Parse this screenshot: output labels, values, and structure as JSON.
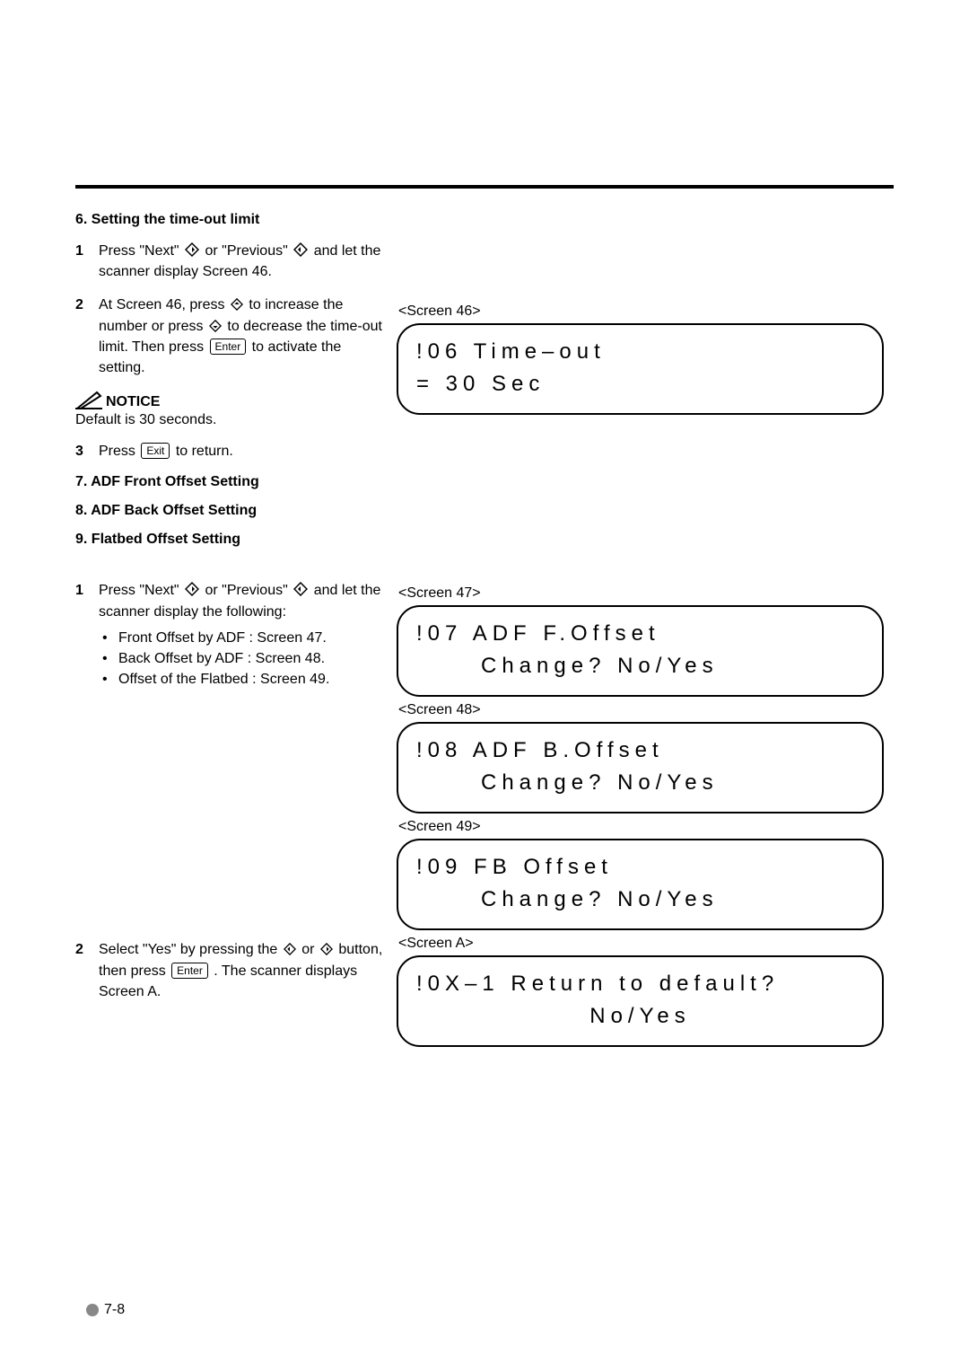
{
  "section6": {
    "heading": "6. Setting the time-out limit",
    "step1_part1": "Press \"Next\" ",
    "step1_part2": " or \"Previous\" ",
    "step1_part3": " and let the scanner display Screen 46.",
    "step2_part1": "At Screen 46, press ",
    "step2_part2": " to increase the number or press ",
    "step2_part3": " to decrease the time-out limit. Then press ",
    "step2_key_enter": "Enter",
    "step2_part4": " to activate the setting.",
    "notice_label": "NOTICE",
    "notice_text": "Default is 30 seconds.",
    "step3_part1": "Press ",
    "step3_key_exit": "Exit",
    "step3_part2": " to return."
  },
  "section7": {
    "heading": "7. ADF Front Offset Setting"
  },
  "section8": {
    "heading": "8. ADF Back Offset Setting"
  },
  "section9": {
    "heading": "9. Flatbed Offset Setting"
  },
  "offset_steps": {
    "step1_part1": "Press \"Next\" ",
    "step1_part2": " or \"Previous\" ",
    "step1_part3": " and let the scanner display the following:",
    "bullet1": "Front Offset by ADF : Screen 47.",
    "bullet2": "Back Offset by ADF : Screen 48.",
    "bullet3": "Offset of the Flatbed : Screen 49.",
    "step2_part1": "Select \"Yes\" by pressing the ",
    "step2_part2": " or ",
    "step2_part3": " button, then press ",
    "step2_key_enter": "Enter",
    "step2_part4": ". The scanner displays Screen A."
  },
  "screens": {
    "s46_label": "<Screen 46>",
    "s46_line1": "!06 Time–out",
    "s46_line2": " = 30 Sec",
    "s47_label": "<Screen 47>",
    "s47_line1": "!07 ADF F.Offset",
    "s47_line2": "Change? No/Yes",
    "s48_label": "<Screen 48>",
    "s48_line1": "!08 ADF B.Offset",
    "s48_line2": "Change? No/Yes",
    "s49_label": "<Screen 49>",
    "s49_line1": "!09 FB Offset",
    "s49_line2": "Change? No/Yes",
    "sA_label": "<Screen A>",
    "sA_line1": "!0X–1 Return to default?",
    "sA_line2": "No/Yes"
  },
  "nums": {
    "n1": "1",
    "n2": "2",
    "n3": "3"
  },
  "page_number": "7-8"
}
